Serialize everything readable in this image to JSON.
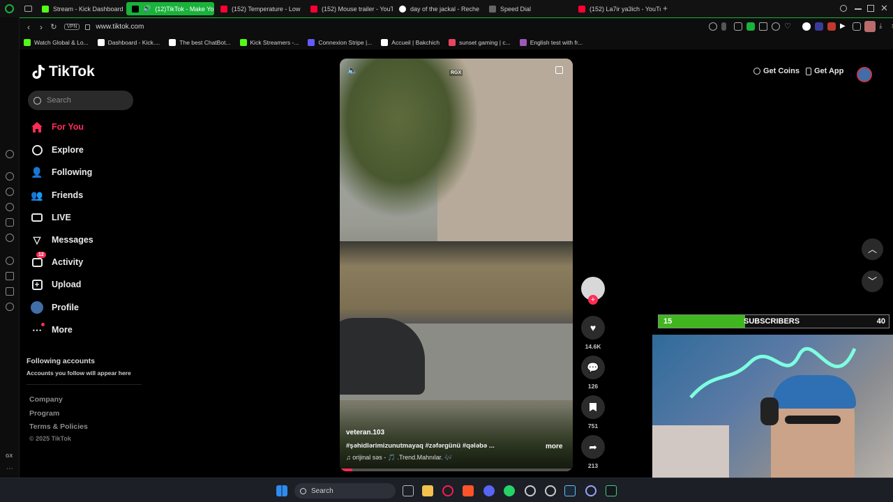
{
  "browser": {
    "tabs": [
      {
        "label": "Stream - Kick Dashboard",
        "color": "#53fc18",
        "active": false
      },
      {
        "label": "(12)TikTok - Make Yo",
        "color": "#000000",
        "active": true
      },
      {
        "label": "(152) Temperature - Low",
        "color": "#ff0033",
        "active": false
      },
      {
        "label": "(152) Mouse trailer - YouT",
        "color": "#ff0033",
        "active": false
      },
      {
        "label": "day of the jackal - Reche",
        "color": "#4285f4",
        "active": false
      },
      {
        "label": "Speed Dial",
        "color": "#666666",
        "active": false
      },
      {
        "label": "(152) La7ir ya3ich - YouTu",
        "color": "#ff0033",
        "active": false
      }
    ],
    "new_tab": "+",
    "vpn_label": "VPN",
    "url": "www.tiktok.com",
    "bookmarks": [
      {
        "label": "Watch Global & Lo...",
        "color": "#53fc18"
      },
      {
        "label": "Dashboard - Kick....",
        "color": "#ffffff"
      },
      {
        "label": "The best ChatBot...",
        "color": "#ffffff"
      },
      {
        "label": "Kick Streamers -...",
        "color": "#53fc18"
      },
      {
        "label": "Connexion Stripe |...",
        "color": "#635bff"
      },
      {
        "label": "Accueil | Bakchich",
        "color": "#ffffff"
      },
      {
        "label": "sunset gaming | c...",
        "color": "#e94560"
      },
      {
        "label": "English test with fr...",
        "color": "#9b59b6"
      }
    ],
    "gx_label": "GX"
  },
  "tiktok": {
    "logo": "TikTok",
    "search_placeholder": "Search",
    "nav": [
      {
        "label": "For You",
        "icon": "home-icon",
        "active": true
      },
      {
        "label": "Explore",
        "icon": "compass-icon"
      },
      {
        "label": "Following",
        "icon": "user-follow-icon"
      },
      {
        "label": "Friends",
        "icon": "friends-icon"
      },
      {
        "label": "LIVE",
        "icon": "live-icon"
      },
      {
        "label": "Messages",
        "icon": "messages-icon"
      },
      {
        "label": "Activity",
        "icon": "activity-icon",
        "badge": "12"
      },
      {
        "label": "Upload",
        "icon": "upload-icon"
      },
      {
        "label": "Profile",
        "icon": "avatar"
      },
      {
        "label": "More",
        "icon": "more-icon"
      }
    ],
    "following_title": "Following accounts",
    "following_sub": "Accounts you follow will appear here",
    "footer": [
      "Company",
      "Program",
      "Terms & Policies"
    ],
    "copyright": "© 2025 TikTok",
    "get_coins": "Get Coins",
    "get_app": "Get App",
    "video": {
      "watermark": "RGX",
      "author": "veteran.103",
      "caption": "#şəhidlərimizunutmayaq  #zəfərgünü  #qələbə  ...",
      "more": "more",
      "sound": "♫ orijinal səs - 🎵 .Trend.Mahnılar. 🎶"
    },
    "actions": {
      "likes": "14.6K",
      "comments": "126",
      "saves": "751",
      "shares": "213"
    }
  },
  "overlay": {
    "sub_current": "15",
    "sub_label": "SUBSCRIBERS",
    "sub_goal": "40",
    "sub_progress": 0.375
  },
  "taskbar": {
    "search": "Search"
  }
}
